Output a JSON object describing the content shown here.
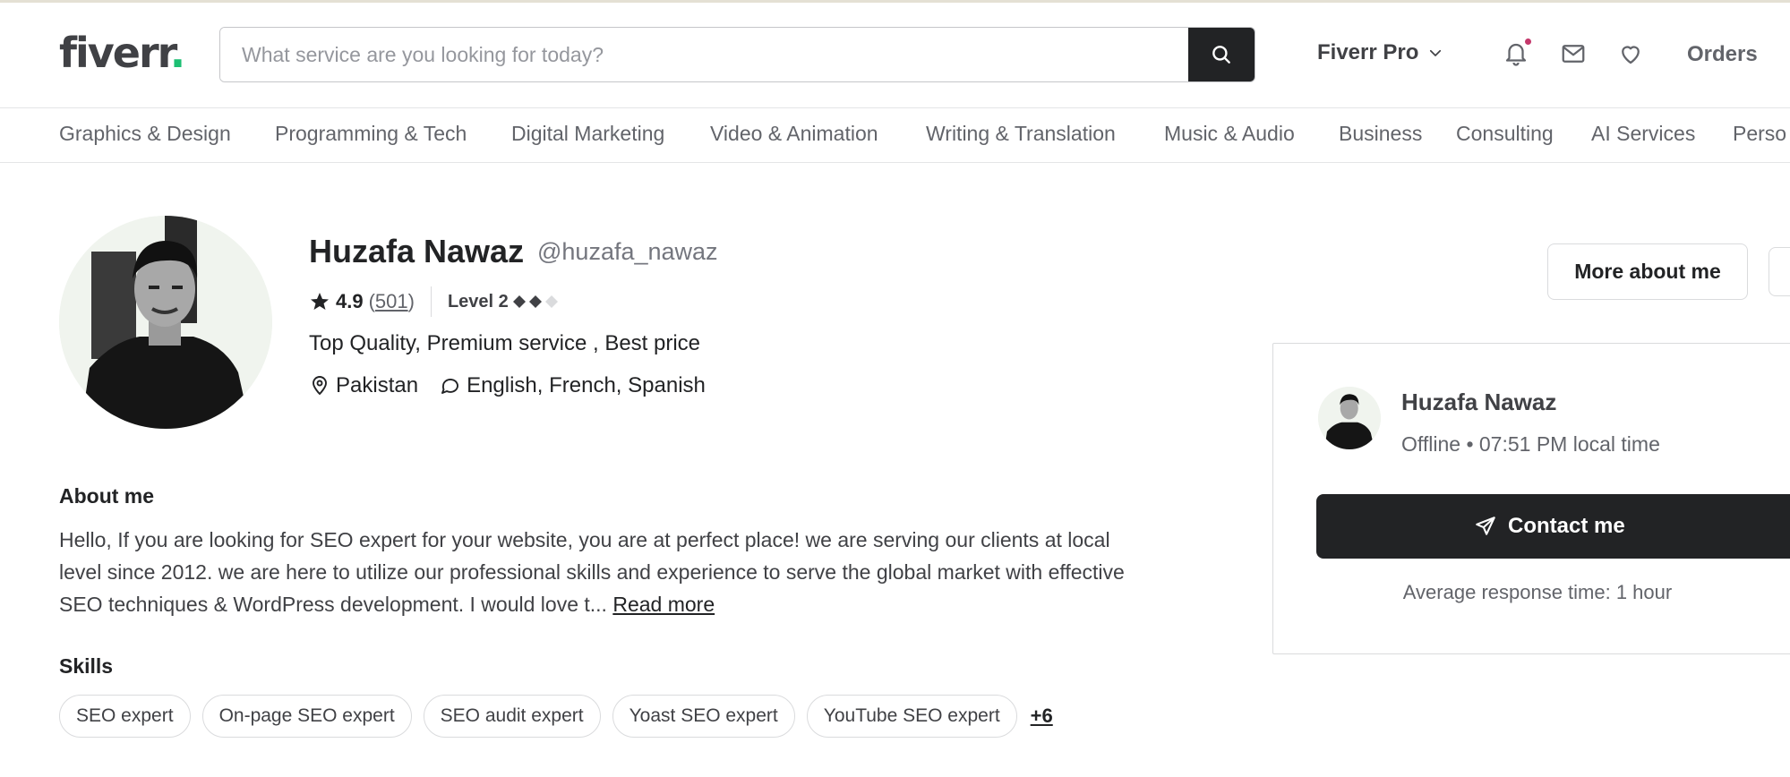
{
  "header": {
    "logo": "fiverr",
    "logo_dot": ".",
    "search_placeholder": "What service are you looking for today?",
    "pro_label": "Fiverr Pro",
    "orders_label": "Orders",
    "brand_color": "#1dbf73"
  },
  "categories": [
    "Graphics & Design",
    "Programming & Tech",
    "Digital Marketing",
    "Video & Animation",
    "Writing & Translation",
    "Music & Audio",
    "Business",
    "Consulting",
    "AI Services",
    "Perso"
  ],
  "profile": {
    "name": "Huzafa Nawaz",
    "handle": "@huzafa_nawaz",
    "rating": "4.9",
    "reviews": "501",
    "paren_open": "(",
    "paren_close": ")",
    "level": "Level 2",
    "level_diamonds_filled": 2,
    "level_diamonds_total": 3,
    "tagline": "Top Quality, Premium service , Best price",
    "country": "Pakistan",
    "languages": "English, French, Spanish",
    "more_about_label": "More about me"
  },
  "about": {
    "title": "About me",
    "text": "Hello, If you are looking for SEO expert for your website, you are at perfect place! we are serving our clients at local level since 2012. we are here to utilize our professional skills and experience to serve the global market with effective SEO techniques & WordPress development. I would love t... ",
    "read_more": "Read more"
  },
  "skills": {
    "title": "Skills",
    "items": [
      "SEO expert",
      "On-page SEO expert",
      "SEO audit expert",
      "Yoast SEO expert",
      "YouTube SEO expert"
    ],
    "more": "+6"
  },
  "contact_card": {
    "name": "Huzafa Nawaz",
    "status": "Offline • 07:51 PM local time",
    "button_label": "Contact me",
    "response": "Average response time: 1 hour"
  }
}
